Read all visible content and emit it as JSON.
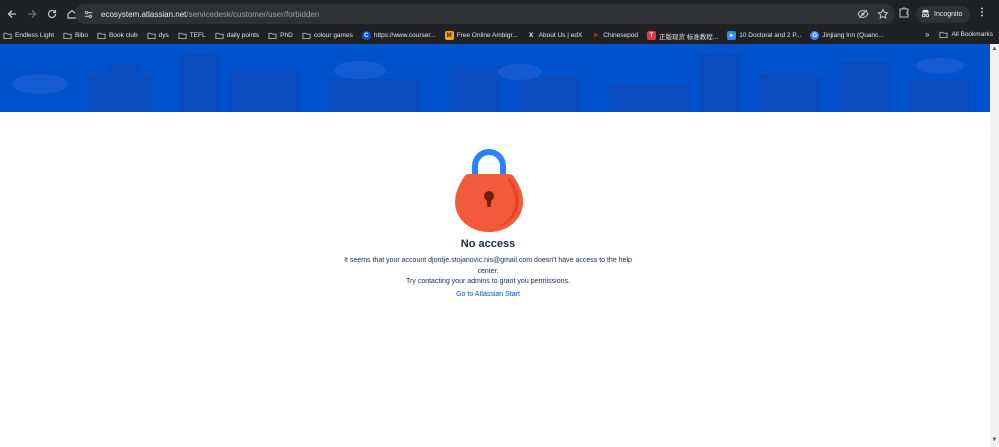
{
  "browser": {
    "url_host": "ecosystem.atlassian.net",
    "url_path": "/servicedesk/customer/user/forbidden",
    "incognito_label": "Incognito",
    "bookmarks": [
      {
        "label": "Endless Light",
        "icon": "folder-icon"
      },
      {
        "label": "Bibo",
        "icon": "folder-icon"
      },
      {
        "label": "Book club",
        "icon": "folder-icon"
      },
      {
        "label": "dys",
        "icon": "folder-icon"
      },
      {
        "label": "TEFL",
        "icon": "folder-icon"
      },
      {
        "label": "daily points",
        "icon": "folder-icon"
      },
      {
        "label": "PhD",
        "icon": "folder-icon"
      },
      {
        "label": "colour games",
        "icon": "folder-icon"
      },
      {
        "label": "https://www.courser...",
        "icon": "coursera-icon"
      },
      {
        "label": "Free Online Ambigr...",
        "icon": "ambigram-icon"
      },
      {
        "label": "About Us | edX",
        "icon": "edx-icon"
      },
      {
        "label": "Chinesepod",
        "icon": "chinesepod-icon"
      },
      {
        "label": "正版现货 标准教程...",
        "icon": "taobao-icon"
      },
      {
        "label": "10 Doctoral and 2 P...",
        "icon": "video-icon"
      },
      {
        "label": "Jinjiang Inn (Quanc...",
        "icon": "google-icon"
      }
    ],
    "all_bookmarks_label": "All Bookmarks"
  },
  "colors": {
    "banner": "#0052cc",
    "heading": "#172b4d",
    "link": "#0052cc",
    "lock_body": "#f15b3b",
    "lock_shackle": "#2684ff"
  },
  "page": {
    "title": "No access",
    "message_line1": "It seems that your account djordje.stojanovic.nis@gmail.com doesn't have access to the help center.",
    "message_line2": "Try contacting your admins to grant you permissions.",
    "link_label": "Go to Atlassian Start"
  }
}
